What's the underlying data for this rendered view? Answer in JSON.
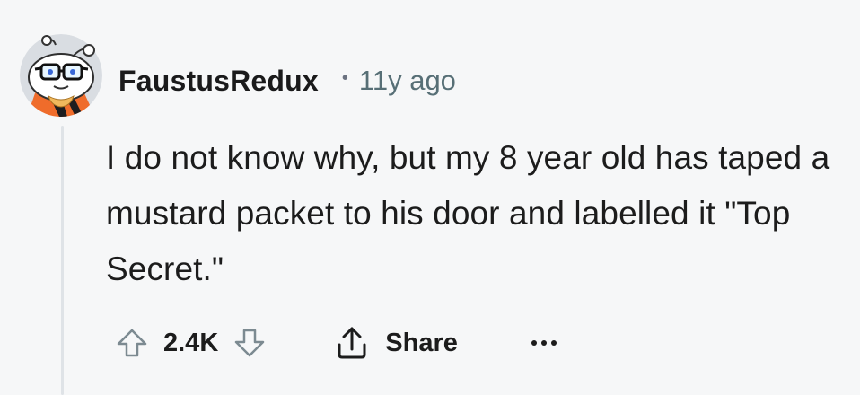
{
  "comment": {
    "author": "FaustusRedux",
    "separator": "•",
    "timestamp": "11y ago",
    "body": "I do not know why, but my 8 year old has taped a mustard packet to his door and labelled it \"Top Secret.\"",
    "score": "2.4K",
    "share_label": "Share"
  },
  "icons": {
    "avatar": "avatar-snoo-glasses-icon",
    "upvote": "arrow-up-outline-icon",
    "downvote": "arrow-down-outline-icon",
    "share": "share-upload-icon",
    "more": "more-horizontal-icon"
  },
  "colors": {
    "background": "#f6f7f8",
    "text": "#1c1c1c",
    "muted": "#576f76",
    "thread_line": "#dfe3e7",
    "icon_outline": "#7c8a91",
    "avatar_orange": "#ef6c2b"
  }
}
